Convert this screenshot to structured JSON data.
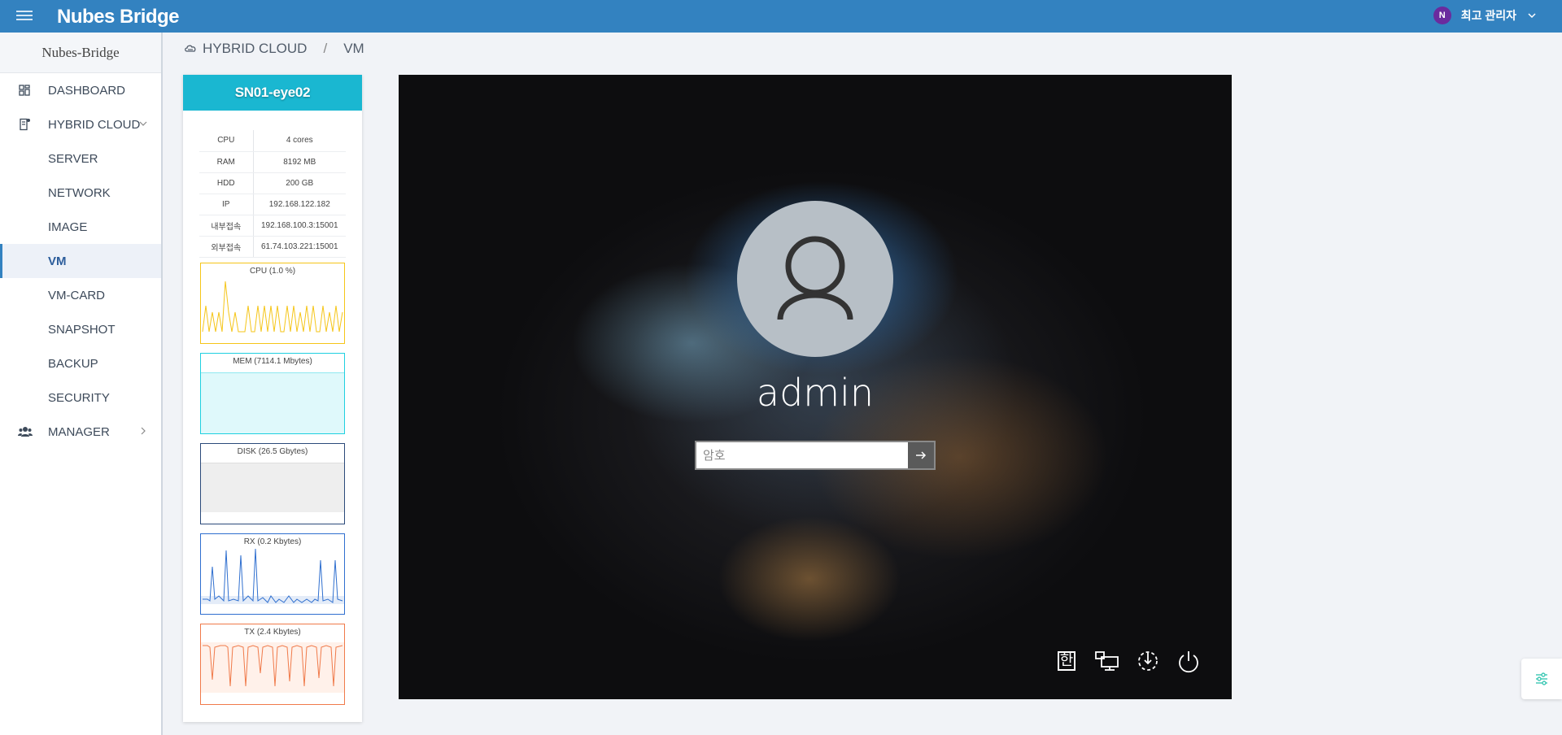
{
  "app": {
    "brand": "Nubes Bridge"
  },
  "header": {
    "user_initial": "N",
    "user_name": "최고 관리자"
  },
  "sidebar": {
    "title": "Nubes-Bridge",
    "items": [
      {
        "label": "DASHBOARD",
        "icon": "dashboard-icon"
      },
      {
        "label": "HYBRID CLOUD",
        "icon": "server-icon"
      },
      {
        "label": "SERVER"
      },
      {
        "label": "NETWORK"
      },
      {
        "label": "IMAGE"
      },
      {
        "label": "VM",
        "active": true
      },
      {
        "label": "VM-CARD"
      },
      {
        "label": "SNAPSHOT"
      },
      {
        "label": "BACKUP"
      },
      {
        "label": "SECURITY"
      },
      {
        "label": "MANAGER",
        "icon": "users-icon"
      }
    ]
  },
  "breadcrumb": {
    "section": "HYBRID CLOUD",
    "separator": "/",
    "page": "VM"
  },
  "vm": {
    "name": "SN01-eye02",
    "specs": [
      {
        "key": "CPU",
        "value": "4 cores"
      },
      {
        "key": "RAM",
        "value": "8192 MB"
      },
      {
        "key": "HDD",
        "value": "200 GB"
      },
      {
        "key": "IP",
        "value": "192.168.122.182"
      },
      {
        "key": "내부접속",
        "value": "192.168.100.3:15001"
      },
      {
        "key": "외부접속",
        "value": "61.74.103.221:15001"
      }
    ],
    "charts": [
      {
        "title": "CPU (1.0 %)",
        "color": "#f5c518"
      },
      {
        "title": "MEM (7114.1 Mbytes)",
        "color": "#1fd0e0"
      },
      {
        "title": "DISK (26.5 Gbytes)",
        "color": "#2b4a7a"
      },
      {
        "title": "RX (0.2 Kbytes)",
        "color": "#2f6fcf"
      },
      {
        "title": "TX (2.4 Kbytes)",
        "color": "#f07a4a"
      }
    ]
  },
  "console": {
    "username": "admin",
    "password_placeholder": "암호",
    "ime_label": "한"
  }
}
